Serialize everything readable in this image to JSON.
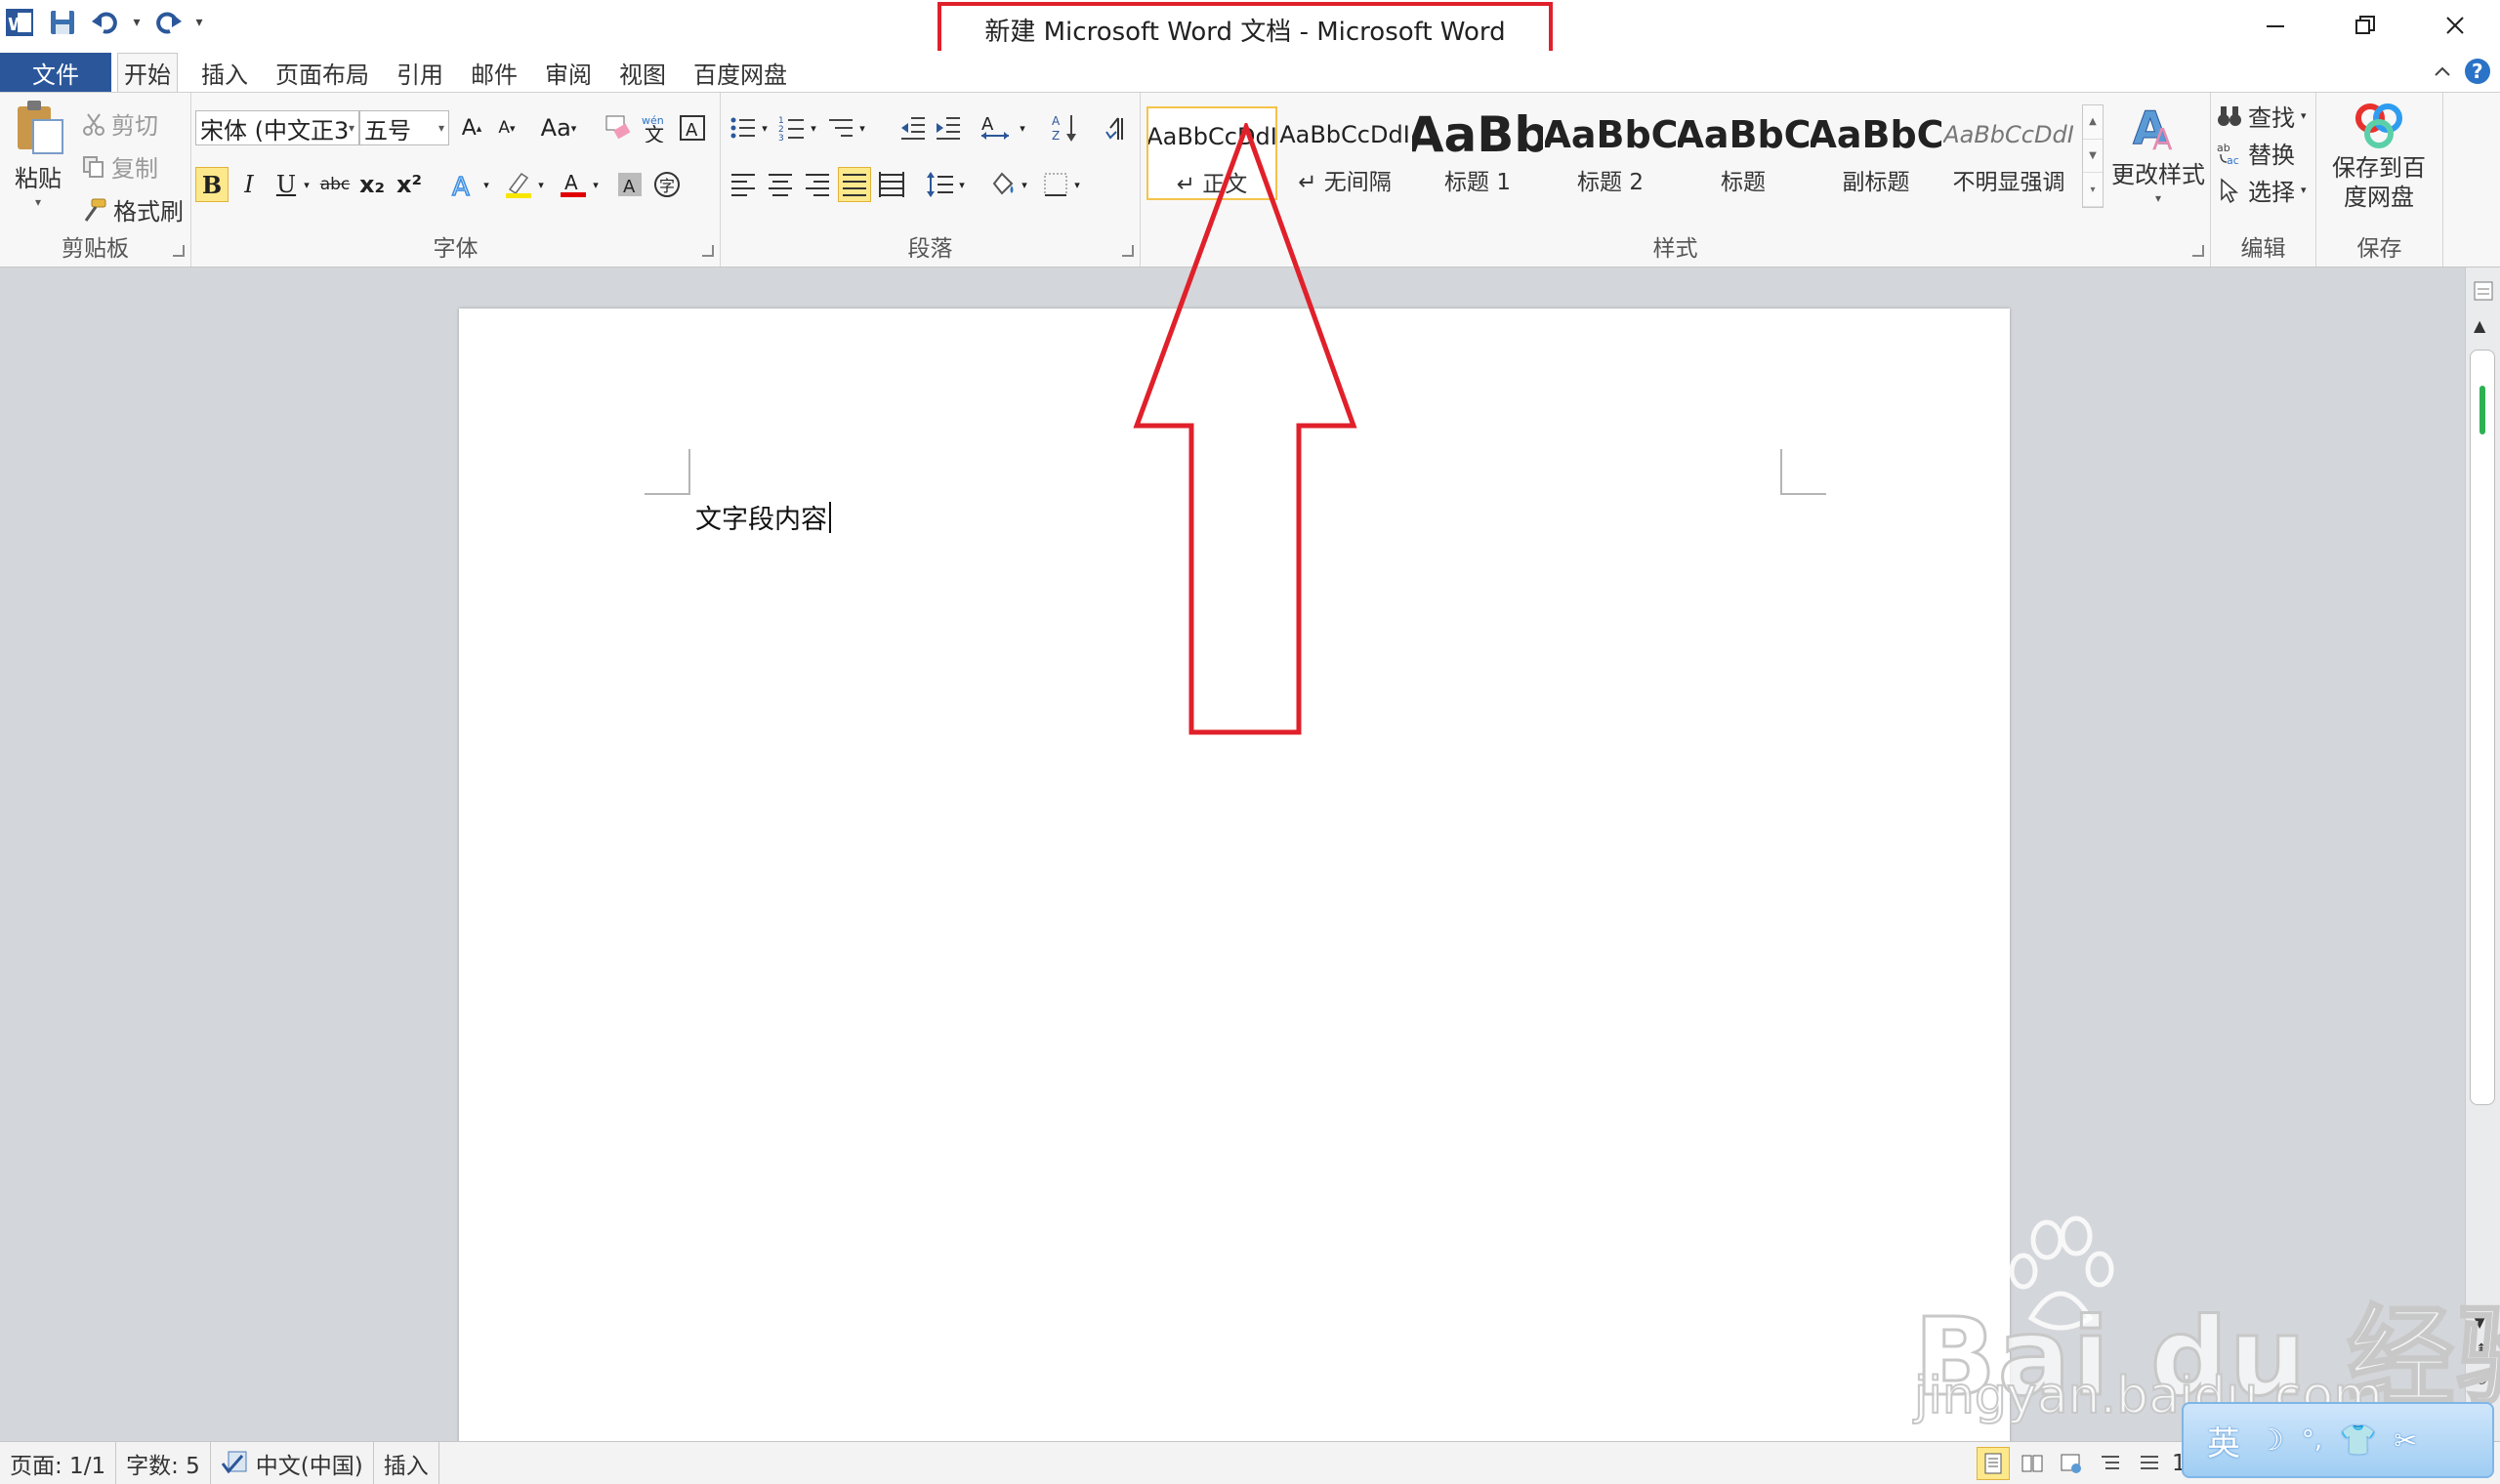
{
  "window": {
    "title": "新建 Microsoft Word 文档 - Microsoft Word"
  },
  "quick_access": {
    "app_icon": "word-icon",
    "save": "save-icon",
    "undo": "undo-icon",
    "redo": "redo-icon",
    "customize": "customize-qat-icon"
  },
  "tabs": {
    "file": "文件",
    "items": [
      "开始",
      "插入",
      "页面布局",
      "引用",
      "邮件",
      "审阅",
      "视图",
      "百度网盘"
    ]
  },
  "clipboard": {
    "paste": "粘贴",
    "cut": "剪切",
    "copy": "复制",
    "format_painter": "格式刷",
    "label": "剪贴板"
  },
  "font": {
    "font_name": "宋体 (中文正3",
    "font_size": "五号",
    "grow": "A",
    "shrink": "A",
    "change_case": "Aa",
    "bold": "B",
    "italic": "I",
    "underline": "U",
    "strike": "abc",
    "subscript": "x₂",
    "superscript": "x²",
    "label": "字体"
  },
  "paragraph": {
    "label": "段落"
  },
  "styles": {
    "label": "样式",
    "items": [
      {
        "sample": "AaBbCcDdI",
        "name": "↵ 正文"
      },
      {
        "sample": "AaBbCcDdI",
        "name": "↵ 无间隔"
      },
      {
        "sample": "AaBb",
        "name": "标题 1"
      },
      {
        "sample": "AaBbC",
        "name": "标题 2"
      },
      {
        "sample": "AaBbC",
        "name": "标题"
      },
      {
        "sample": "AaBbC",
        "name": "副标题"
      },
      {
        "sample": "AaBbCcDdI",
        "name": "不明显强调"
      }
    ],
    "change_styles": "更改样式"
  },
  "editing": {
    "find": "查找",
    "replace": "替换",
    "select": "选择",
    "label": "编辑"
  },
  "save_group": {
    "save_to_baidu": "保存到百度网盘",
    "label": "保存"
  },
  "document": {
    "text": "文字段内容"
  },
  "status": {
    "page": "页面: 1/1",
    "words": "字数: 5",
    "language": "中文(中国)",
    "mode": "插入",
    "zoom_fragment": "1"
  },
  "ime": {
    "lang": "英"
  },
  "watermark": {
    "brand": "Bai du 经验",
    "url": "jingyan.baidu.com"
  },
  "colors": {
    "file_tab": "#2b579a",
    "annotation": "#e0202a",
    "highlight": "#fde98c",
    "font_color_red": "#e00000",
    "highlight_yellow": "#f7e600"
  }
}
